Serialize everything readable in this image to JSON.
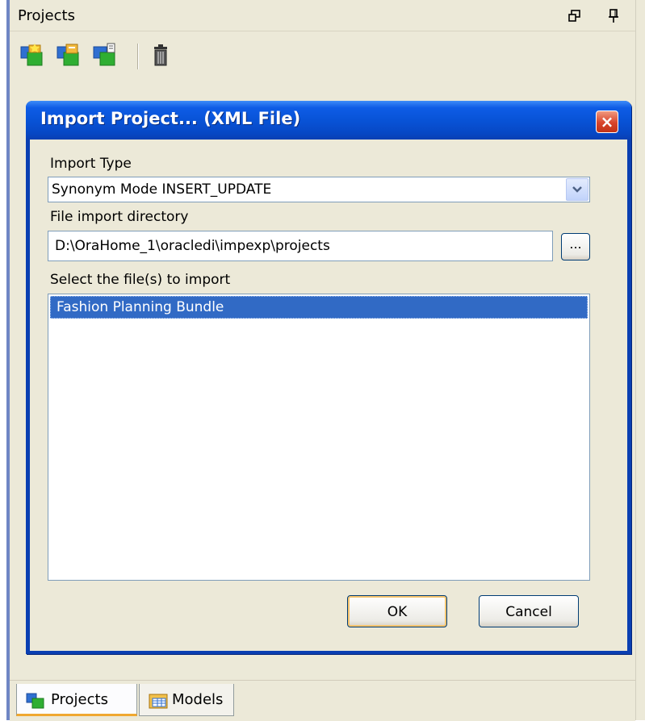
{
  "panel": {
    "title": "Projects"
  },
  "dialog": {
    "title": "Import Project... (XML File)",
    "close_label": "×",
    "import_type_label": "Import Type",
    "import_type_value": "Synonym Mode INSERT_UPDATE",
    "directory_label": "File import directory",
    "directory_value": "D:\\OraHome_1\\oracledi\\impexp\\projects",
    "browse_label": "...",
    "files_label": "Select the file(s) to import",
    "files": [
      {
        "name": "Fashion Planning Bundle",
        "selected": true
      }
    ],
    "ok_label": "OK",
    "cancel_label": "Cancel"
  },
  "tabs": [
    {
      "label": "Projects",
      "icon": "projects-icon",
      "active": true
    },
    {
      "label": "Models",
      "icon": "models-icon",
      "active": false
    }
  ],
  "colors": {
    "titlebar": "#0853d7",
    "selection": "#316ac5",
    "panel_bg": "#ece9d8"
  }
}
